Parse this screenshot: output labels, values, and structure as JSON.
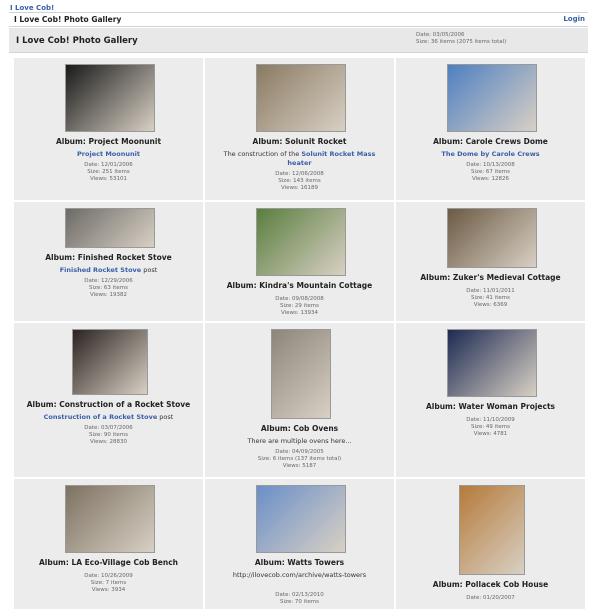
{
  "breadcrumb": "I Love Cob!",
  "topbar": {
    "title": "I Love Cob! Photo Gallery",
    "login": "Login"
  },
  "header": {
    "title": "I Love Cob! Photo Gallery",
    "date": "Date: 03/05/2006",
    "size": "Size: 36 items (2075 items total)"
  },
  "albums": [
    {
      "title": "Album: Project Moonunit",
      "desc_pre": "",
      "desc_link": "Project Moonunit",
      "desc_post": "",
      "date": "Date: 12/01/2006",
      "size": "Size: 251 items",
      "views": "Views: 53101",
      "thumb_color": "#1a1a1a"
    },
    {
      "title": "Album: Solunit Rocket",
      "desc_pre": "The construction of the ",
      "desc_link": "Solunit Rocket Mass heater",
      "desc_post": "",
      "date": "Date: 12/06/2008",
      "size": "Size: 143 items",
      "views": "Views: 16189",
      "thumb_color": "#8a7a63"
    },
    {
      "title": "Album: Carole Crews Dome",
      "desc_pre": "",
      "desc_link": "The Dome by Carole Crews",
      "desc_post": "",
      "date": "Date: 10/13/2008",
      "size": "Size: 67 items",
      "views": "Views: 12826",
      "thumb_color": "#4f7fc2"
    },
    {
      "title": "Album: Finished Rocket Stove",
      "desc_pre": "",
      "desc_link": "Finished Rocket Stove",
      "desc_post": " post",
      "date": "Date: 12/29/2006",
      "size": "Size: 63 items",
      "views": "Views: 19382",
      "thumb_color": "#6d6a66"
    },
    {
      "title": "Album: Kindra's Mountain Cottage",
      "desc_pre": "",
      "desc_link": "",
      "desc_post": "",
      "date": "Date: 09/08/2008",
      "size": "Size: 29 items",
      "views": "Views: 13934",
      "thumb_color": "#5a7e3e"
    },
    {
      "title": "Album: Zuker's Medieval Cottage",
      "desc_pre": "",
      "desc_link": "",
      "desc_post": "",
      "date": "Date: 11/01/2011",
      "size": "Size: 41 items",
      "views": "Views: 6369",
      "thumb_color": "#6b5a44"
    },
    {
      "title": "Album: Construction of a Rocket Stove",
      "desc_pre": "",
      "desc_link": "Construction of a Rocket Stove",
      "desc_post": " post",
      "date": "Date: 03/07/2006",
      "size": "Size: 90 items",
      "views": "Views: 28830",
      "thumb_color": "#2a2320"
    },
    {
      "title": "Album: Cob Ovens",
      "desc_pre": "There are multiple ovens here...",
      "desc_link": "",
      "desc_post": "",
      "date": "Date: 04/09/2005",
      "size": "Size: 6 items (137 items total)",
      "views": "Views: 5187",
      "thumb_color": "#8c8579"
    },
    {
      "title": "Album: Water Woman Projects",
      "desc_pre": "",
      "desc_link": "",
      "desc_post": "",
      "date": "Date: 11/10/2009",
      "size": "Size: 49 items",
      "views": "Views: 4781",
      "thumb_color": "#1d2a52"
    },
    {
      "title": "Album: LA Eco-Village Cob Bench",
      "desc_pre": "",
      "desc_link": "",
      "desc_post": "",
      "date": "Date: 10/26/2009",
      "size": "Size: 7 items",
      "views": "Views: 3934",
      "thumb_color": "#7d7161"
    },
    {
      "title": "Album: Watts Towers",
      "desc_pre": "http://ilovecob.com/archive/watts-towers",
      "desc_link": "",
      "desc_post": "",
      "date": "Date: 02/13/2010",
      "size": "Size: 70 items",
      "views": "",
      "thumb_color": "#6a8fc9"
    },
    {
      "title": "Album: Pollacek Cob House",
      "desc_pre": "",
      "desc_link": "",
      "desc_post": "",
      "date": "Date: 01/20/2007",
      "size": "",
      "views": "",
      "thumb_color": "#b57a3a"
    }
  ]
}
